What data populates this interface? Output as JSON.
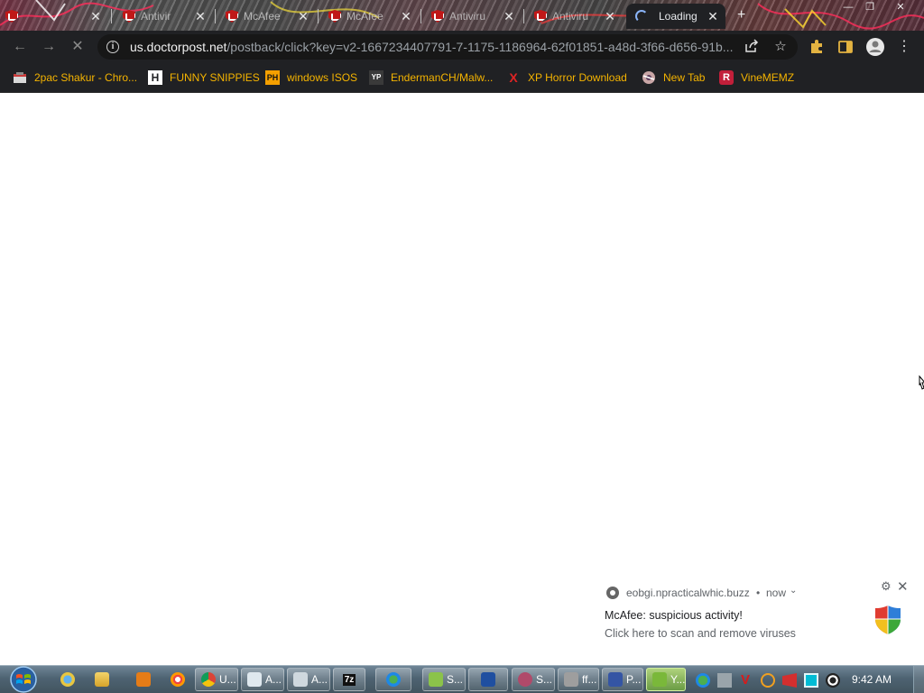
{
  "browser": {
    "tabs": [
      {
        "title": "",
        "icon": "mcafee-shield-icon",
        "active": false
      },
      {
        "title": "Antivir",
        "icon": "mcafee-shield-icon",
        "active": false
      },
      {
        "title": "McAfee",
        "icon": "mcafee-shield-icon",
        "active": false
      },
      {
        "title": "McAfee",
        "icon": "mcafee-shield-icon",
        "active": false
      },
      {
        "title": "Antiviru",
        "icon": "mcafee-shield-icon",
        "active": false
      },
      {
        "title": "Antiviru",
        "icon": "mcafee-shield-icon",
        "active": false
      },
      {
        "title": "Loading",
        "icon": "loading-spinner-icon",
        "active": true
      }
    ],
    "tab_close_glyph": "✕",
    "new_tab_glyph": "+",
    "url_host": "us.doctorpost.net",
    "url_path": "/postback/click?key=v2-1667234407791-7-1175-1186964-62f01851-a48d-3f66-d656-91b...",
    "bookmarks": [
      {
        "label": "2pac Shakur - Chro...",
        "icon": "bookmark-favicon-2pac"
      },
      {
        "label": "FUNNY SNIPPIES",
        "icon": "bookmark-favicon-h"
      },
      {
        "label": "windows ISOS",
        "icon": "bookmark-favicon-ph"
      },
      {
        "label": "EndermanCH/Malw...",
        "icon": "bookmark-favicon-yp"
      },
      {
        "label": "XP Horror Download",
        "icon": "bookmark-favicon-x"
      },
      {
        "label": "New Tab",
        "icon": "bookmark-favicon-newtab"
      },
      {
        "label": "VineMEMZ",
        "icon": "bookmark-favicon-r"
      }
    ],
    "bookmark_icon_text": {
      "h": "H",
      "ph": "PH",
      "yp": "YP",
      "x": "X",
      "r": "R"
    }
  },
  "notification": {
    "source": "eobgi.npracticalwhic.buzz",
    "separator": "•",
    "time": "now",
    "title": "McAfee: suspicious activity!",
    "body": "Click here to scan and remove viruses"
  },
  "taskbar": {
    "items": [
      {
        "label": "U...",
        "icon": "chrome-icon"
      },
      {
        "label": "A...",
        "icon": "window-app-icon"
      },
      {
        "label": "A...",
        "icon": "window-app-icon-2"
      },
      {
        "label": "7z",
        "icon": "7zip-icon"
      },
      {
        "label": "",
        "icon": "globe-app-icon"
      },
      {
        "label": "S...",
        "icon": "folder-app-icon"
      },
      {
        "label": "",
        "icon": "yb-app-icon"
      },
      {
        "label": "S...",
        "icon": "s-app-icon"
      },
      {
        "label": "ff...",
        "icon": "ff-app-icon"
      },
      {
        "label": "P...",
        "icon": "p-app-icon"
      },
      {
        "label": "Y...",
        "icon": "y-app-icon"
      }
    ],
    "clock": "9:42 AM"
  },
  "colors": {
    "chrome_dark": "#202124",
    "bookmark_text": "#f5b400",
    "mcafee_red": "#c01818",
    "taskbar": "#4e6372"
  }
}
